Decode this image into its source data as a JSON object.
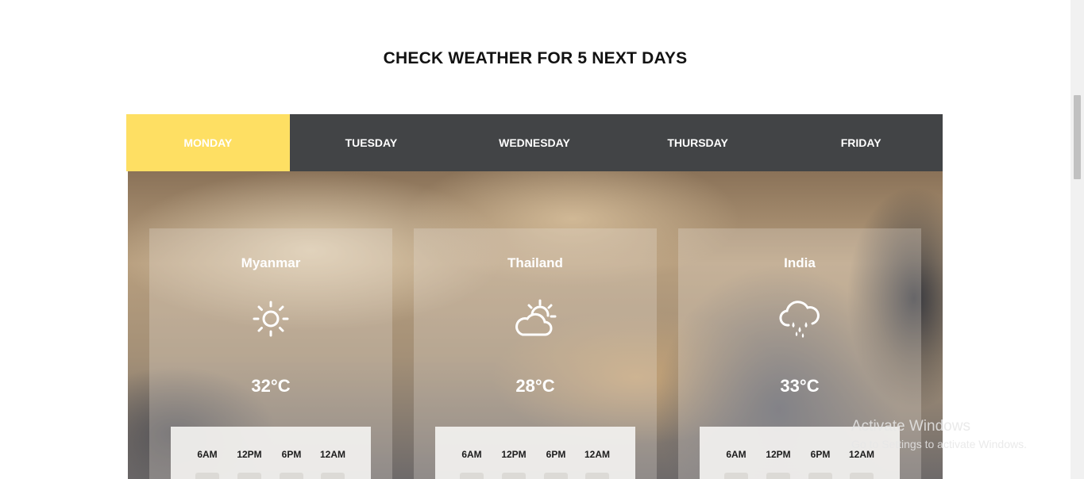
{
  "page_title": "CHECK WEATHER FOR 5 NEXT DAYS",
  "tabs": [
    {
      "label": "MONDAY",
      "active": true
    },
    {
      "label": "TUESDAY",
      "active": false
    },
    {
      "label": "WEDNESDAY",
      "active": false
    },
    {
      "label": "THURSDAY",
      "active": false
    },
    {
      "label": "FRIDAY",
      "active": false
    }
  ],
  "cards": [
    {
      "city": "Myanmar",
      "icon": "sun-icon",
      "temp": "32°C",
      "hours": [
        "6AM",
        "12PM",
        "6PM",
        "12AM"
      ]
    },
    {
      "city": "Thailand",
      "icon": "partly-cloudy-icon",
      "temp": "28°C",
      "hours": [
        "6AM",
        "12PM",
        "6PM",
        "12AM"
      ]
    },
    {
      "city": "India",
      "icon": "rain-cloud-icon",
      "temp": "33°C",
      "hours": [
        "6AM",
        "12PM",
        "6PM",
        "12AM"
      ]
    }
  ],
  "watermark": {
    "line1": "Activate Windows",
    "line2": "Go to Settings to activate Windows."
  },
  "colors": {
    "active_tab": "#fedf63",
    "tab_bar": "#424446"
  }
}
